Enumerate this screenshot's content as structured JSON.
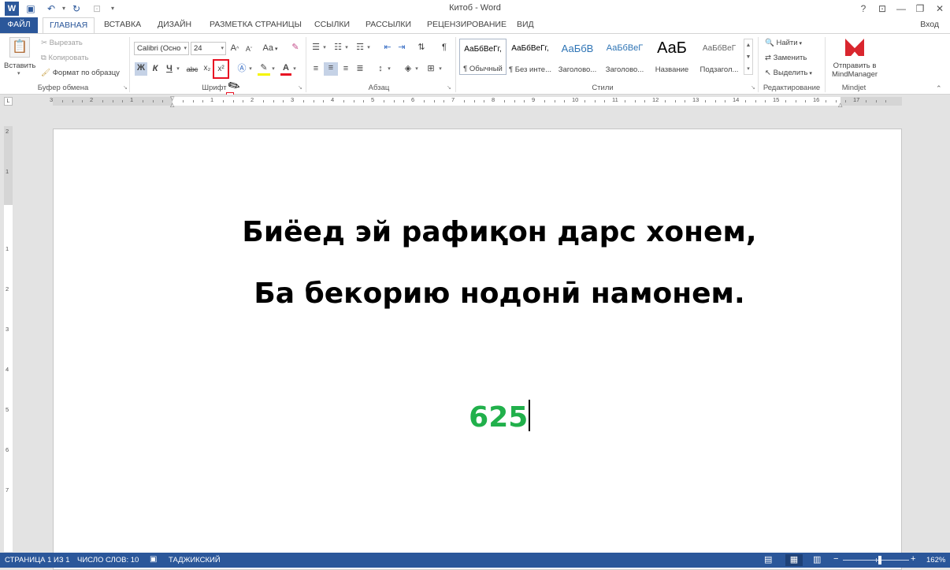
{
  "window": {
    "title": "Китоб - Word",
    "signin": "Вход",
    "help": "?",
    "min": "—",
    "restore": "❐",
    "close": "✕",
    "ribbon_display": "⊡"
  },
  "tabs": [
    "ФАЙЛ",
    "ГЛАВНАЯ",
    "ВСТАВКА",
    "ДИЗАЙН",
    "РАЗМЕТКА СТРАНИЦЫ",
    "ССЫЛКИ",
    "РАССЫЛКИ",
    "РЕЦЕНЗИРОВАНИЕ",
    "ВИД"
  ],
  "clipboard": {
    "paste": "Вставить",
    "cut": "Вырезать",
    "copy": "Копировать",
    "format_painter": "Формат по образцу",
    "label": "Буфер обмена"
  },
  "font": {
    "name": "Calibri (Осно",
    "size": "24",
    "bold": "Ж",
    "italic": "К",
    "underline": "Ч",
    "strike": "abc",
    "subscript": "x₂",
    "superscript": "x²",
    "grow": "A",
    "shrink": "A",
    "case": "Aa",
    "label": "Шрифт"
  },
  "paragraph": {
    "label": "Абзац",
    "pilcrow": "¶"
  },
  "styles": {
    "label": "Стили",
    "items": [
      {
        "preview": "АаБбВеГг,",
        "name": "¶ Обычный"
      },
      {
        "preview": "АаБбВеГг,",
        "name": "¶ Без инте..."
      },
      {
        "preview": "АаБбВ",
        "name": "Заголово..."
      },
      {
        "preview": "АаБбВеГ",
        "name": "Заголово..."
      },
      {
        "preview": "АаБ",
        "name": "Название"
      },
      {
        "preview": "АаБбВеГ",
        "name": "Подзагол..."
      }
    ]
  },
  "editing": {
    "find": "Найти",
    "replace": "Заменить",
    "select": "Выделить",
    "label": "Редактирование"
  },
  "mindjet": {
    "send_line1": "Отправить в",
    "send_line2": "MindManager",
    "label": "Mindjet"
  },
  "document": {
    "line1": "Биёед эй рафиқон дарс хонем,",
    "line2": "Ба бекорию нодонӣ намонем.",
    "number": "625"
  },
  "ruler": {
    "h_numbers": [
      "3",
      "2",
      "1",
      "1",
      "2",
      "3",
      "4",
      "5",
      "6",
      "7",
      "8",
      "9",
      "10",
      "11",
      "12",
      "13",
      "14",
      "15",
      "16",
      "17"
    ],
    "v_numbers": [
      "2",
      "1",
      "1",
      "2",
      "3",
      "4",
      "5",
      "6",
      "7"
    ]
  },
  "status": {
    "page": "СТРАНИЦА 1 ИЗ 1",
    "words": "ЧИСЛО СЛОВ: 10",
    "language": "ТАДЖИКСКИЙ",
    "zoom": "162%"
  },
  "colors": {
    "accent": "#2b579a",
    "number_green": "#21b04b",
    "highlight_red": "#e81123"
  }
}
